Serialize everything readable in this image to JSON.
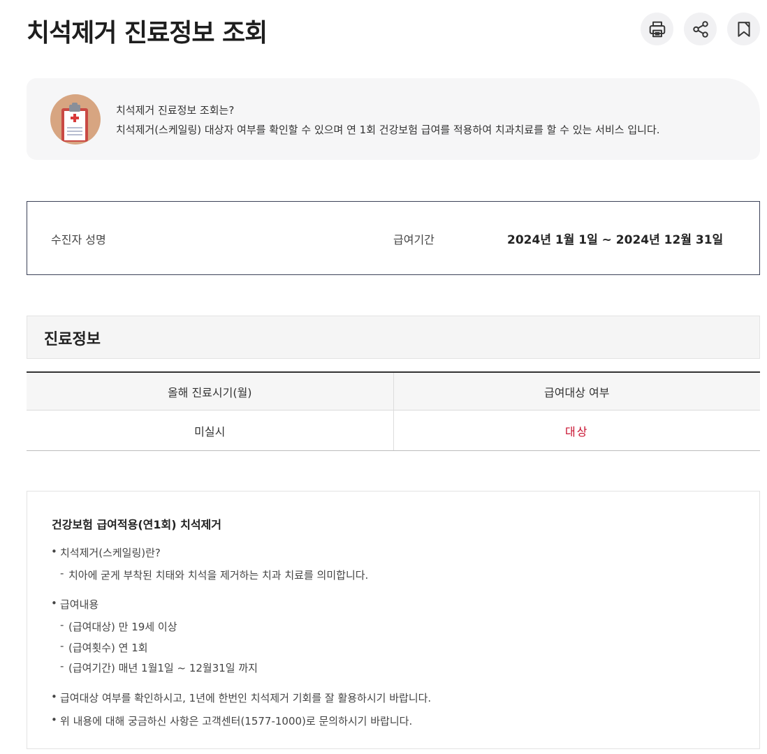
{
  "header": {
    "title": "치석제거 진료정보 조회",
    "actions": [
      {
        "name": "print-icon"
      },
      {
        "name": "share-icon"
      },
      {
        "name": "bookmark-icon"
      }
    ]
  },
  "info": {
    "icon": "clipboard-medical-icon",
    "question": "치석제거 진료정보 조회는?",
    "description": "치석제거(스케일링) 대상자 여부를 확인할 수 있으며 연 1회 건강보험 급여를 적용하여 치과치료를 할 수 있는 서비스 입니다."
  },
  "patient": {
    "name_label": "수진자 성명",
    "period_label": "급여기간",
    "period_value": "2024년 1월 1일 ~ 2024년 12월 31일"
  },
  "section": {
    "title": "진료정보"
  },
  "table": {
    "headers": [
      "올해 진료시기(월)",
      "급여대상 여부"
    ],
    "rows": [
      [
        "미실시",
        "대상"
      ]
    ]
  },
  "notice": {
    "title": "건강보험 급여적용(연1회) 치석제거",
    "items": [
      {
        "text": "치석제거(스케일링)란?",
        "sub": [
          "치아에 굳게 부착된 치태와 치석을 제거하는 치과 치료를 의미합니다."
        ]
      },
      {
        "text": "급여내용",
        "sub": [
          "(급여대상) 만 19세 이상",
          "(급여횟수) 연 1회",
          "(급여기간) 매년 1월1일 ~ 12월31일 까지"
        ]
      },
      {
        "text": "급여대상 여부를 확인하시고, 1년에 한번인 치석제거 기회를 잘 활용하시기 바랍니다.",
        "sub": []
      },
      {
        "text": "위 내용에 대해 궁금하신 사항은 고객센터(1577-1000)로 문의하시기 바랍니다.",
        "sub": []
      }
    ]
  },
  "colors": {
    "accent_red": "#c8102e",
    "border_dark": "#3b4157"
  }
}
